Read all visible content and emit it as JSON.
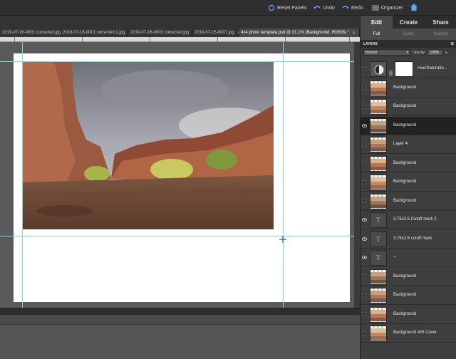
{
  "topbar": {
    "reset_panels": "Reset Panels",
    "undo": "Undo",
    "redo": "Redo",
    "organizer": "Organizer"
  },
  "doc_tabs": [
    {
      "label": "2019-07-16-0001 corrected.jpg"
    },
    {
      "label": "2019-07-16-0001 corrected 2.jpg"
    },
    {
      "label": "2019-07-16-0003 corrected.jpg"
    },
    {
      "label": "2019-07-15-0007.jpg"
    },
    {
      "label": "4x4 photo template.psd @ 31.1% (Background, RGB/8) *"
    }
  ],
  "mode_tabs": {
    "edit": "Edit",
    "create": "Create",
    "share": "Share"
  },
  "sub_tabs": {
    "full": "Full",
    "quick": "Quick",
    "guided": "Guided"
  },
  "layers_panel": {
    "title": "LAYERS",
    "blend_mode": "Normal",
    "opacity_label": "Opacity:",
    "opacity_value": "100%"
  },
  "layers": [
    {
      "name": "Hue/Saturatio...",
      "kind": "adjustment",
      "visible": false,
      "selected": false
    },
    {
      "name": "Background",
      "kind": "image",
      "visible": false,
      "selected": false
    },
    {
      "name": "Background",
      "kind": "image",
      "visible": false,
      "selected": false
    },
    {
      "name": "Background",
      "kind": "image",
      "visible": true,
      "selected": true
    },
    {
      "name": "Layer 4",
      "kind": "image",
      "visible": false,
      "selected": false
    },
    {
      "name": "Background",
      "kind": "image",
      "visible": false,
      "selected": false
    },
    {
      "name": "Background",
      "kind": "image",
      "visible": false,
      "selected": false
    },
    {
      "name": "Background",
      "kind": "image",
      "visible": false,
      "selected": false
    },
    {
      "name": "3.75x2.5 Cutoff mark 2",
      "kind": "type",
      "visible": true,
      "selected": false
    },
    {
      "name": "3.75x2.5 cutoff mark",
      "kind": "type",
      "visible": true,
      "selected": false
    },
    {
      "name": "--",
      "kind": "type",
      "visible": true,
      "selected": false
    },
    {
      "name": "Background",
      "kind": "image",
      "visible": false,
      "selected": false
    },
    {
      "name": "Background",
      "kind": "image",
      "visible": false,
      "selected": false
    },
    {
      "name": "Background",
      "kind": "image",
      "visible": false,
      "selected": false
    },
    {
      "name": "Background 4x5 Cover",
      "kind": "image",
      "visible": false,
      "selected": false
    }
  ],
  "colors": {
    "accent": "#1e90ff",
    "guide": "#7fd8e6",
    "panel_bg": "#3e3e3e",
    "selected_layer": "#222222"
  }
}
